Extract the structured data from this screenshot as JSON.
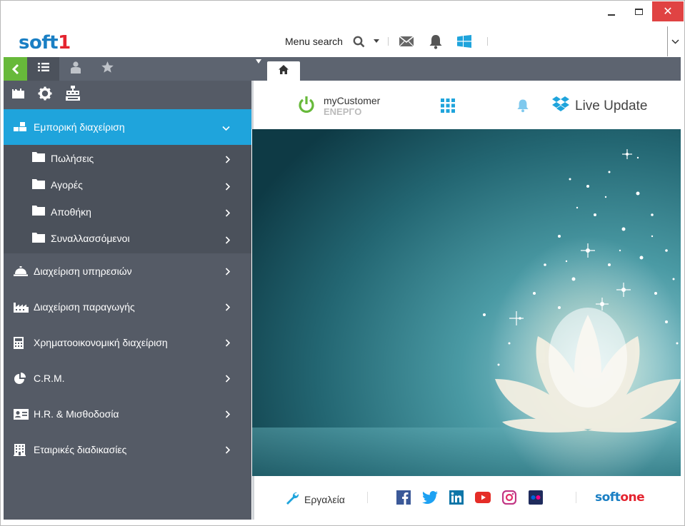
{
  "window": {
    "minimize": "–",
    "maximize": "□",
    "close": "✕"
  },
  "brand": {
    "logo_a": "soft",
    "logo_b": "1",
    "footer_a": "soft",
    "footer_b": "one"
  },
  "topbar": {
    "menu_search_label": "Menu search",
    "icons": [
      "search-icon",
      "dropdown-caret-icon",
      "mail-icon",
      "bell-icon",
      "windows-icon"
    ]
  },
  "tabs": {
    "left": [
      "back",
      "menu-list",
      "user",
      "favorites"
    ],
    "right": [
      "home"
    ]
  },
  "sidebar": {
    "tool_icons": [
      "folder-icon",
      "gear-icon",
      "workflow-icon"
    ],
    "items": [
      {
        "label": "Εμπορική διαχείριση",
        "icon": "commerce-icon",
        "expanded": true,
        "children": [
          "Πωλήσεις",
          "Αγορές",
          "Αποθήκη",
          "Συναλλασσόμενοι"
        ]
      },
      {
        "label": "Διαχείριση υπηρεσιών",
        "icon": "service-bell-icon"
      },
      {
        "label": "Διαχείριση παραγωγής",
        "icon": "factory-icon"
      },
      {
        "label": "Χρηματοοικονομική διαχείριση",
        "icon": "calculator-icon"
      },
      {
        "label": "C.R.M.",
        "icon": "pie-chart-icon"
      },
      {
        "label": "H.R. & Μισθοδοσία",
        "icon": "id-card-icon"
      },
      {
        "label": "Εταιρικές διαδικασίες",
        "icon": "building-icon"
      }
    ]
  },
  "main": {
    "customer_name": "myCustomer",
    "customer_status": "ΕΝΕΡΓΟ",
    "live_update": "Live Update"
  },
  "footer": {
    "tools_label": "Εργαλεία",
    "social": [
      "facebook-icon",
      "twitter-icon",
      "linkedin-icon",
      "youtube-icon",
      "instagram-icon",
      "flickr-icon"
    ]
  },
  "colors": {
    "accent": "#1fa4dc",
    "green": "#67b93a",
    "sidebar": "#555b66",
    "brand_blue": "#1a7fc4",
    "brand_red": "#e4242f"
  }
}
